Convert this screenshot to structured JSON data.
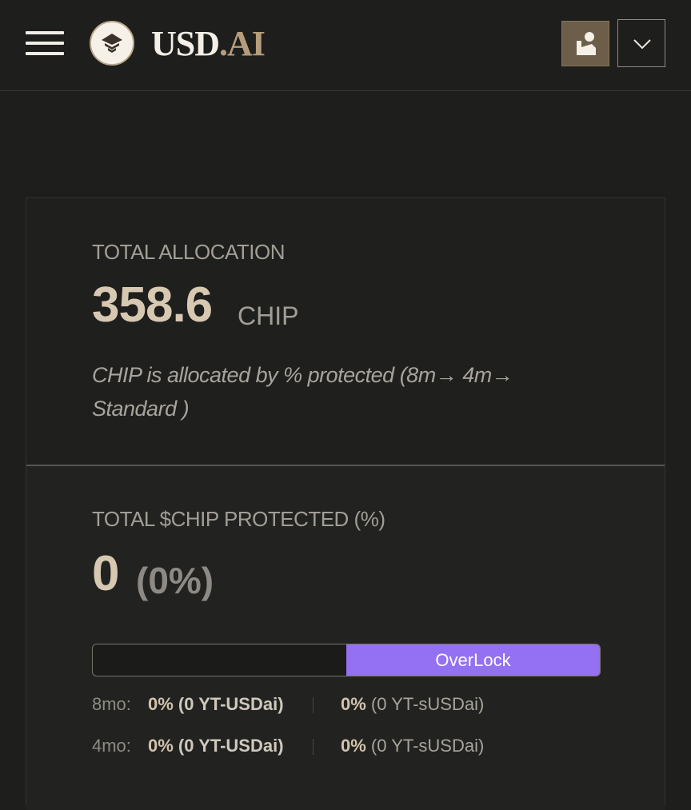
{
  "header": {
    "logo_text_main": "USD",
    "logo_text_accent": ".AI",
    "icons": {
      "menu": "hamburger-menu-icon",
      "logo": "usdai-logo-icon",
      "wallet": "wallet-avatar-icon",
      "dropdown": "chevron-down-icon"
    }
  },
  "allocation": {
    "label": "TOTAL ALLOCATION",
    "value": "358.6",
    "unit": "CHIP",
    "description": "CHIP is allocated by % protected (8m→ 4m→ Standard )"
  },
  "protected": {
    "label": "TOTAL $CHIP PROTECTED (%)",
    "value": "0",
    "percent": "(0%)",
    "bar_label": "OverLock",
    "bar_fill_fraction": 0.5,
    "accent_color": "#9470f2"
  },
  "breakdown": [
    {
      "term": "8mo:",
      "usdai_pct": "0%",
      "usdai_amount": "(0 YT-USDai)",
      "susdai_pct": "0%",
      "susdai_amount": "(0 YT-sUSDai)"
    },
    {
      "term": "4mo:",
      "usdai_pct": "0%",
      "usdai_amount": "(0 YT-USDai)",
      "susdai_pct": "0%",
      "susdai_amount": "(0 YT-sUSDai)"
    }
  ]
}
